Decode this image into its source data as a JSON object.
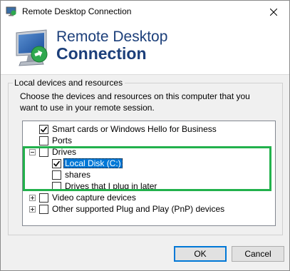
{
  "window": {
    "title": "Remote Desktop Connection"
  },
  "banner": {
    "line1": "Remote Desktop",
    "line2": "Connection"
  },
  "group": {
    "title": "Local devices and resources",
    "description": "Choose the devices and resources on this computer that you want to use in your remote session."
  },
  "tree": {
    "items": [
      {
        "label": "Smart cards or Windows Hello for Business",
        "checked": true
      },
      {
        "label": "Ports",
        "checked": false
      },
      {
        "label": "Drives",
        "checked": false,
        "expander": "minus"
      },
      {
        "label": "Local Disk (C:)",
        "checked": true,
        "selected": true
      },
      {
        "label": "shares",
        "checked": false
      },
      {
        "label": "Drives that I plug in later",
        "checked": false
      },
      {
        "label": "Video capture devices",
        "checked": false,
        "expander": "plus"
      },
      {
        "label": "Other supported Plug and Play (PnP) devices",
        "checked": false,
        "expander": "plus"
      }
    ]
  },
  "buttons": {
    "ok": "OK",
    "cancel": "Cancel"
  },
  "colors": {
    "highlight": "#22b14c",
    "selection": "#0078d7",
    "title": "#1c3f7a"
  }
}
